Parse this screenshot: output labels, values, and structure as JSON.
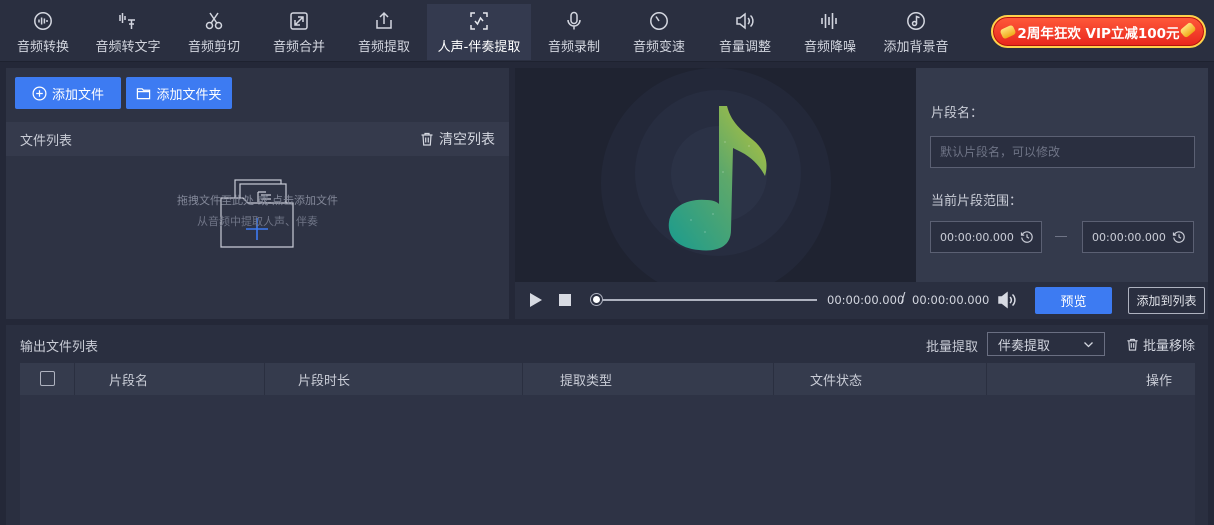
{
  "toolbar": {
    "items": [
      {
        "label": "音频转换",
        "icon": "waveform-circle-icon"
      },
      {
        "label": "音频转文字",
        "icon": "voice-text-icon"
      },
      {
        "label": "音频剪切",
        "icon": "scissors-icon"
      },
      {
        "label": "音频合并",
        "icon": "merge-icon"
      },
      {
        "label": "音频提取",
        "icon": "upload-extract-icon"
      },
      {
        "label": "人声-伴奏提取",
        "icon": "vocal-scan-icon"
      },
      {
        "label": "音频录制",
        "icon": "microphone-icon"
      },
      {
        "label": "音频变速",
        "icon": "speed-dial-icon"
      },
      {
        "label": "音量调整",
        "icon": "volume-adjust-icon"
      },
      {
        "label": "音频降噪",
        "icon": "noise-bars-icon"
      },
      {
        "label": "添加背景音",
        "icon": "music-note-circle-icon"
      }
    ],
    "active_index": 5,
    "promo": "2周年狂欢 VIP立减100元"
  },
  "left_panel": {
    "add_file": "添加文件",
    "add_folder": "添加文件夹",
    "file_list_title": "文件列表",
    "clear_list": "清空列表",
    "drop_hint": "拖拽文件至此处 或 点击添加文件",
    "drop_sub_hint": "从音频中提取人声、伴奏"
  },
  "player": {
    "current_time": "00:00:00.000",
    "separator": "/",
    "total_time": "00:00:00.000",
    "progress": 0,
    "preview_button": "预览",
    "add_to_list_button": "添加到列表"
  },
  "segment": {
    "name_label": "片段名：",
    "name_placeholder": "默认片段名，可以修改",
    "range_label": "当前片段范围：",
    "start_time": "00:00:00.000",
    "end_time": "00:00:00.000"
  },
  "output": {
    "title": "输出文件列表",
    "batch_extract_label": "批量提取",
    "batch_extract_value": "伴奏提取",
    "batch_remove": "批量移除",
    "columns": [
      "片段名",
      "片段时长",
      "提取类型",
      "文件状态",
      "操作"
    ],
    "rows": []
  },
  "colors": {
    "accent": "#3d7bf2",
    "promo_red": "#e8261c",
    "promo_border": "#ffd24a"
  }
}
